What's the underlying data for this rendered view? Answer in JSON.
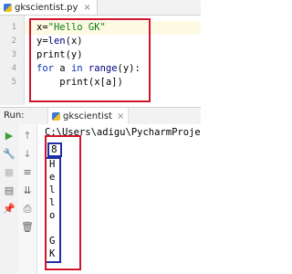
{
  "tab": {
    "filename": "gkscientist.py"
  },
  "editor": {
    "line_numbers": [
      "1",
      "2",
      "3",
      "4",
      "5"
    ],
    "lines": [
      {
        "text": "x=\"Hello GK\""
      },
      {
        "text": "y=len(x)"
      },
      {
        "text": "print(y)"
      },
      {
        "text": "for a in range(y):"
      },
      {
        "text": "    print(x[a])"
      }
    ]
  },
  "run": {
    "label": "Run:",
    "tab": "gkscientist"
  },
  "console": {
    "path": "C:\\Users\\adigu\\PycharmProje",
    "output": [
      "8",
      "H",
      "e",
      "l",
      "l",
      "o",
      "",
      "G",
      "K"
    ]
  },
  "colors": {
    "highlight_red": "#d1162c",
    "highlight_blue": "#1f2ea8",
    "keyword": "#0033b3",
    "string": "#067d17"
  },
  "icons": {
    "left_toolbar": [
      "run-icon",
      "wrench-icon",
      "stop-icon",
      "layout-icon",
      "pin-icon"
    ],
    "right_toolbar": [
      "arrow-up-icon",
      "arrow-down-icon",
      "wrap-icon",
      "scroll-end-icon",
      "print-icon",
      "trash-icon"
    ]
  }
}
